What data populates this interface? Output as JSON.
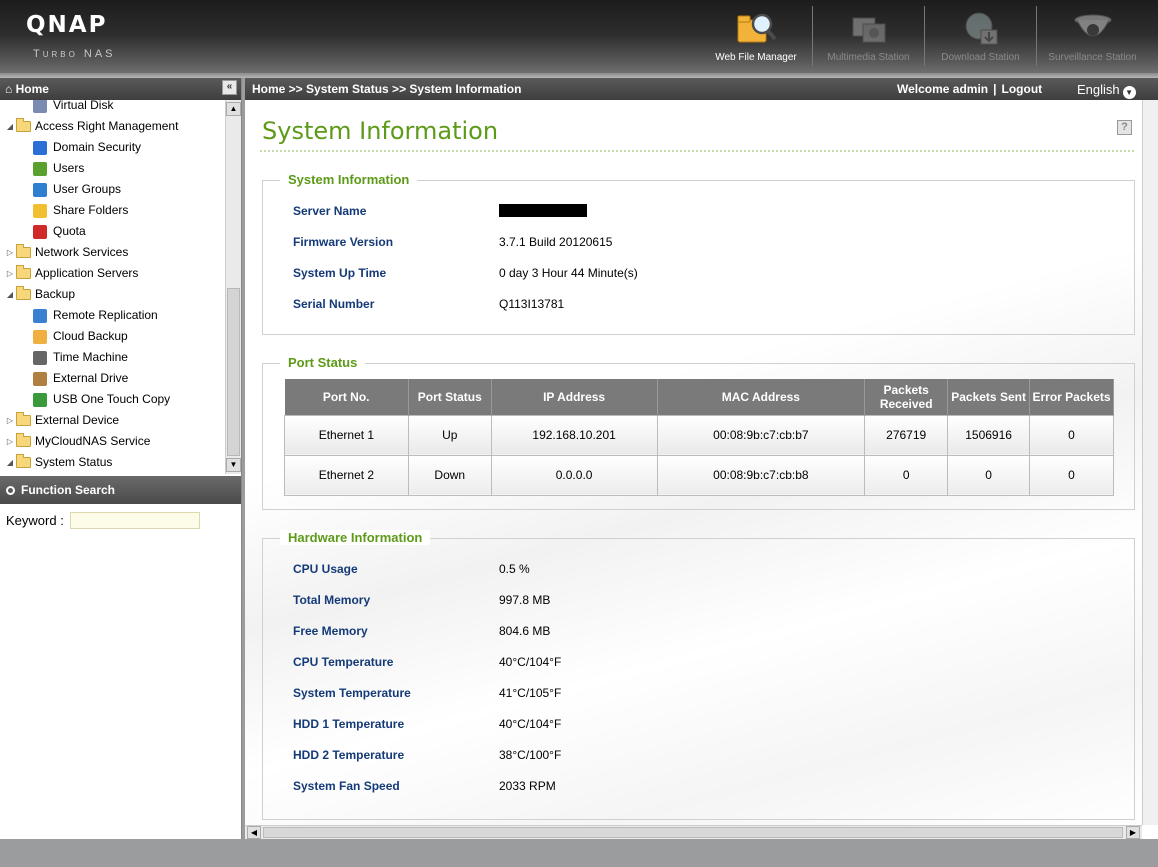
{
  "header": {
    "logo": "QNAP",
    "sublogo": "Turbo NAS",
    "apps": [
      {
        "label": "Web File Manager",
        "icon": "folder-search-icon",
        "active": true
      },
      {
        "label": "Multimedia Station",
        "icon": "multimedia-icon",
        "active": false
      },
      {
        "label": "Download Station",
        "icon": "download-globe-icon",
        "active": false
      },
      {
        "label": "Surveillance Station",
        "icon": "camera-icon",
        "active": false
      }
    ]
  },
  "sidebar": {
    "home_label": "Home",
    "collapse_glyph": "«",
    "tree": [
      {
        "label": "Virtual Disk",
        "level": 2,
        "icon": "virtual-disk-icon",
        "color": "#7a8ab0"
      },
      {
        "label": "Access Right Management",
        "level": 1,
        "expanded": true
      },
      {
        "label": "Domain Security",
        "level": 2,
        "icon": "domain-security-icon",
        "color": "#2a6fd6"
      },
      {
        "label": "Users",
        "level": 2,
        "icon": "user-icon",
        "color": "#5aa02c"
      },
      {
        "label": "User Groups",
        "level": 2,
        "icon": "user-groups-icon",
        "color": "#2f7fd0"
      },
      {
        "label": "Share Folders",
        "level": 2,
        "icon": "share-folder-icon",
        "color": "#f0c030"
      },
      {
        "label": "Quota",
        "level": 2,
        "icon": "quota-icon",
        "color": "#d02828"
      },
      {
        "label": "Network Services",
        "level": 1,
        "expanded": false
      },
      {
        "label": "Application Servers",
        "level": 1,
        "expanded": false
      },
      {
        "label": "Backup",
        "level": 1,
        "expanded": true
      },
      {
        "label": "Remote Replication",
        "level": 2,
        "icon": "remote-replication-icon",
        "color": "#3a80d0"
      },
      {
        "label": "Cloud Backup",
        "level": 2,
        "icon": "cloud-backup-icon",
        "color": "#f0b040"
      },
      {
        "label": "Time Machine",
        "level": 2,
        "icon": "apple-icon",
        "color": "#666666"
      },
      {
        "label": "External Drive",
        "level": 2,
        "icon": "external-drive-icon",
        "color": "#b08040"
      },
      {
        "label": "USB One Touch Copy",
        "level": 2,
        "icon": "usb-icon",
        "color": "#3a9a3a"
      },
      {
        "label": "External Device",
        "level": 1,
        "expanded": false
      },
      {
        "label": "MyCloudNAS Service",
        "level": 1,
        "expanded": false
      },
      {
        "label": "System Status",
        "level": 1,
        "expanded": true
      }
    ],
    "function_search_label": "Function Search",
    "keyword_label": "Keyword :",
    "keyword_value": ""
  },
  "topbar": {
    "breadcrumb": "Home >> System Status >> System Information",
    "welcome": "Welcome admin",
    "divider": "|",
    "logout": "Logout",
    "language": "English"
  },
  "page": {
    "title": "System Information",
    "help_glyph": "?",
    "system_info": {
      "legend": "System Information",
      "rows": [
        {
          "key": "Server Name",
          "value": "",
          "redacted": true
        },
        {
          "key": "Firmware Version",
          "value": "3.7.1 Build 20120615"
        },
        {
          "key": "System Up Time",
          "value": "0  day  3  Hour  44  Minute(s)"
        },
        {
          "key": "Serial Number",
          "value": "Q113I13781"
        }
      ]
    },
    "port_status": {
      "legend": "Port Status",
      "columns": [
        "Port No.",
        "Port Status",
        "IP Address",
        "MAC Address",
        "Packets Received",
        "Packets Sent",
        "Error Packets"
      ],
      "rows": [
        [
          "Ethernet 1",
          "Up",
          "192.168.10.201",
          "00:08:9b:c7:cb:b7",
          "276719",
          "1506916",
          "0"
        ],
        [
          "Ethernet 2",
          "Down",
          "0.0.0.0",
          "00:08:9b:c7:cb:b8",
          "0",
          "0",
          "0"
        ]
      ]
    },
    "hardware_info": {
      "legend": "Hardware Information",
      "rows": [
        {
          "key": "CPU Usage",
          "value": "0.5 %"
        },
        {
          "key": "Total Memory",
          "value": "997.8  MB"
        },
        {
          "key": "Free Memory",
          "value": "804.6  MB"
        },
        {
          "key": "CPU Temperature",
          "value": "40°C/104°F"
        },
        {
          "key": "System Temperature",
          "value": "41°C/105°F"
        },
        {
          "key": "HDD 1 Temperature",
          "value": "40°C/104°F"
        },
        {
          "key": "HDD 2 Temperature",
          "value": "38°C/100°F"
        },
        {
          "key": "System Fan Speed",
          "value": "2033 RPM"
        }
      ]
    }
  },
  "colors": {
    "accent_green": "#5c9a18",
    "label_blue": "#143a78",
    "header_gray": "#7a7a7a"
  }
}
